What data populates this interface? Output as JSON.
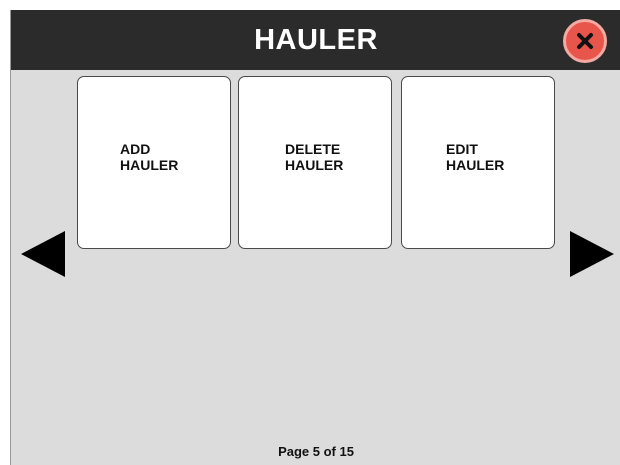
{
  "window": {
    "title": "HAULER",
    "close_icon": "close-icon",
    "colors": {
      "titlebar": "#2b2b2b",
      "background": "#dcdcdc",
      "close_button": "#e8554a"
    }
  },
  "tiles": [
    {
      "label": "ADD\nHAULER"
    },
    {
      "label": "DELETE\nHAULER"
    },
    {
      "label": "EDIT\nHAULER"
    }
  ],
  "navigation": {
    "prev_icon": "arrow-left-icon",
    "next_icon": "arrow-right-icon"
  },
  "pagination": {
    "text": "Page 5 of 15"
  }
}
